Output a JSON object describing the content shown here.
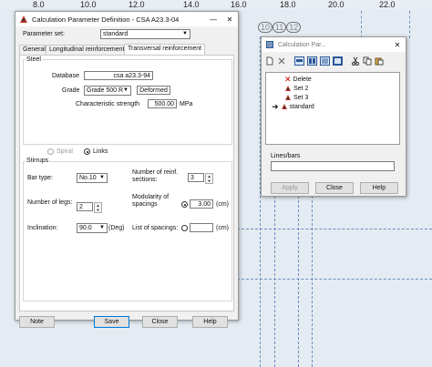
{
  "ruler": {
    "ticks": [
      "8.0",
      "10.0",
      "12.0",
      "14.0",
      "16.0",
      "18.0",
      "20.0",
      "22.0"
    ]
  },
  "axes_labels": [
    "10",
    "11",
    "12"
  ],
  "main": {
    "title": "Calculation Parameter Definition - CSA A23.3-04",
    "minimize": "—",
    "close": "✕",
    "parameter_set_label": "Parameter set:",
    "parameter_set_value": "standard",
    "tabs": [
      "General",
      "Longitudinal reinforcement",
      "Transversal reinforcement"
    ],
    "steel": {
      "title": "Steel",
      "database_label": "Database",
      "database_value": "csa a23.3-94",
      "grade_label": "Grade",
      "grade_value": "Grade 500 R",
      "deformed": "Deformed",
      "strength_label": "Characteristic strength",
      "strength_value": "500.00",
      "strength_unit": "MPa"
    },
    "spiral_label": "Spiral",
    "links_label": "Links",
    "stirrups": {
      "title": "Stirrups",
      "bar_type_label": "Bar type:",
      "bar_type_value": "No.10",
      "reinf_sections_label": "Number of reinf. sections:",
      "reinf_sections_value": "3",
      "legs_label": "Number of legs:",
      "legs_value": "2",
      "modularity_label": "Modularity of spacings",
      "modularity_value": "3.00",
      "modularity_unit": "(cm)",
      "inclination_label": "Inclination:",
      "inclination_value": "90.0",
      "inclination_unit": "(Deg)",
      "list_label": "List of spacings:",
      "list_value": "",
      "list_unit": "(cm)"
    },
    "buttons": {
      "note": "Note",
      "save": "Save",
      "close": "Close",
      "help": "Help"
    }
  },
  "sets": {
    "title": "Calculation Par...",
    "close": "✕",
    "items": [
      "Delete",
      "Set 2",
      "Set 3",
      "standard"
    ],
    "lines_label": "Lines/bars",
    "lines_value": "",
    "buttons": {
      "apply": "Apply",
      "close": "Close",
      "help": "Help"
    }
  }
}
